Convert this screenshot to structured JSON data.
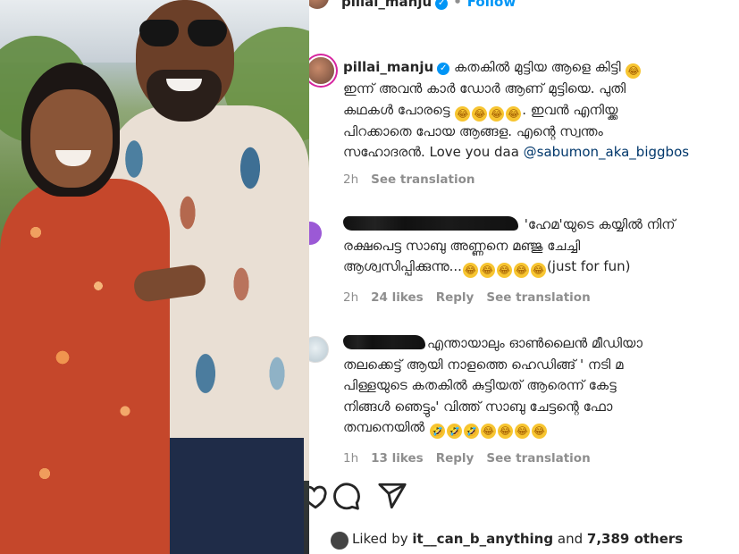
{
  "post": {
    "username": "pillai_manju",
    "follow_label": "Follow",
    "caption_user": "pillai_manju",
    "caption_line1": "കതകിൽ മുട്ടിയ ആളെ കിട്ടി",
    "caption_line2": "ഇന്ന് അവൻ കാർ ഡോർ ആണ് മുട്ടിയെ. പുതി",
    "caption_line3": "കഥകൾ പോരട്ടെ",
    "caption_line3b": ". ഇവൻ എനിയ്ക്ക",
    "caption_line4": "പിറക്കാതെ പോയ ആങ്ങള. എന്റെ സ്വന്തം",
    "caption_line5": "സഹോദരൻ. Love you daa",
    "caption_mention": "@sabumon_aka_biggbos",
    "caption_time": "2h",
    "caption_see_translation": "See translation"
  },
  "comments": [
    {
      "text_line1": "'ഹേമ'യുടെ കയ്യിൽ നിന്",
      "text_line2": "രക്ഷപെട്ട സാബു അണ്ണനെ മഞ്ജു ചേച്ചി",
      "text_line3": "ആശ്വസിപ്പിക്കുന്നു...",
      "text_suffix": "(just for fun)",
      "time": "2h",
      "likes": "24 likes",
      "reply": "Reply",
      "see_translation": "See translation"
    },
    {
      "text_line1": "എന്തായാലും ഓൺലൈൻ മീഡിയാ",
      "text_line2": "തലക്കെട്ട് ആയി നാളത്തെ ഹെഡിങ്ങ് ' നടി മ",
      "text_line3": "പിള്ളയുടെ കതകിൽ കുട്ടിയത് ആരെന്ന് കേട്ട",
      "text_line4": "നിങ്ങൾ ഞെട്ടും' വിത്ത് സാബു ചേട്ടന്റെ ഫോ",
      "text_line5": "തമ്പനെയിൽ",
      "time": "1h",
      "likes": "13 likes",
      "reply": "Reply",
      "see_translation": "See translation"
    }
  ],
  "footer": {
    "liked_by_prefix": "Liked by",
    "liked_by_user": "it__can_b_anything",
    "liked_by_and": "and",
    "liked_by_others": "7,389 others"
  },
  "icons": [
    "heart-icon",
    "comment-icon",
    "share-icon"
  ],
  "colors": {
    "link": "#0095f6",
    "mention": "#00376b",
    "muted": "#8e8e8e",
    "text": "#262626"
  }
}
